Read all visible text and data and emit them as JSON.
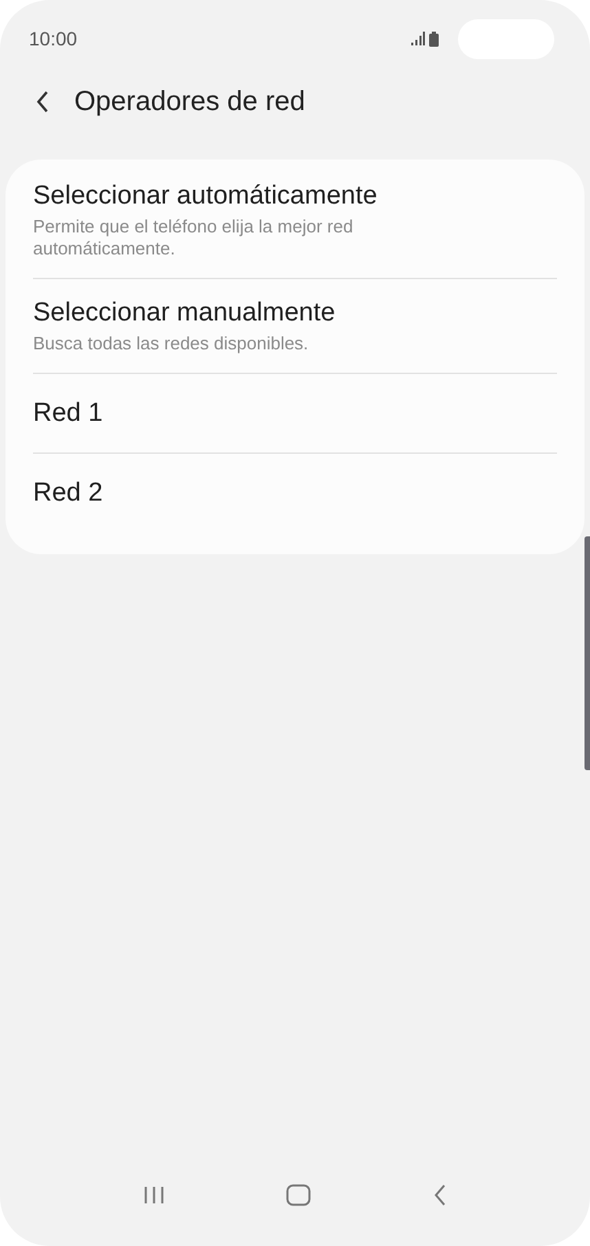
{
  "status_bar": {
    "time": "10:00"
  },
  "header": {
    "title": "Operadores de red"
  },
  "items": [
    {
      "title": "Seleccionar automáticamente",
      "subtitle": "Permite que el teléfono elija la mejor red automáticamente."
    },
    {
      "title": "Seleccionar manualmente",
      "subtitle": "Busca todas las redes disponibles."
    },
    {
      "title": "Red 1"
    },
    {
      "title": "Red 2"
    }
  ]
}
